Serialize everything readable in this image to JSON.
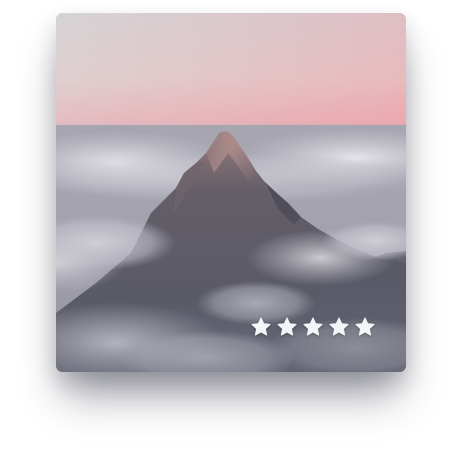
{
  "card": {
    "image": "mountain-peak-above-clouds",
    "rating": {
      "value": 5,
      "max": 5,
      "star_color": "#f4f5f8"
    }
  }
}
